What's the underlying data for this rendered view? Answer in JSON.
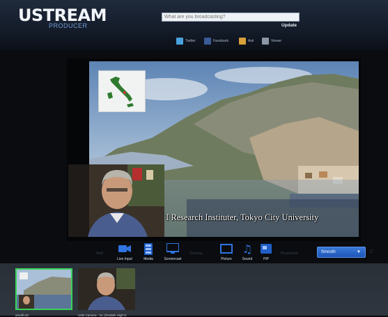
{
  "header": {
    "logo": "USTREAM",
    "logo_sub": "PRODUCER",
    "status_placeholder": "What are you broadcasting?",
    "update_label": "Update",
    "social": [
      {
        "label": "Twitter",
        "icon": "twitter-icon",
        "color": "#4aa3df"
      },
      {
        "label": "Facebook",
        "icon": "facebook-icon",
        "color": "#3b5b98"
      },
      {
        "label": "Ask",
        "icon": "ask-icon",
        "color": "#d8a13a"
      },
      {
        "label": "Viewer",
        "icon": "viewer-icon",
        "color": "#8b96a6"
      }
    ]
  },
  "stage": {
    "caption": "I Research Instituter, Tokyo City University"
  },
  "toolbar": {
    "groups": [
      "Add",
      "Overlay",
      "Broadcast"
    ],
    "add_items": [
      {
        "label": "Live Input",
        "icon": "camera-icon"
      },
      {
        "label": "Media",
        "icon": "film-icon"
      },
      {
        "label": "Screencast",
        "icon": "monitor-icon"
      }
    ],
    "overlay_items": [
      {
        "label": "Picture",
        "icon": "picture-icon"
      },
      {
        "label": "Sound",
        "icon": "music-note-icon"
      },
      {
        "label": "PiP",
        "icon": "pip-icon"
      }
    ],
    "quality": "Smooth",
    "quality_caret": "▼",
    "channel_mark": "C"
  },
  "sources": [
    {
      "name": "amalfi.avi",
      "selected": true
    },
    {
      "name": "USB Camera - Inc (Realtek High D",
      "selected": false
    }
  ],
  "colors": {
    "accent_blue": "#2a66cc",
    "selected_green": "#39d35a"
  }
}
